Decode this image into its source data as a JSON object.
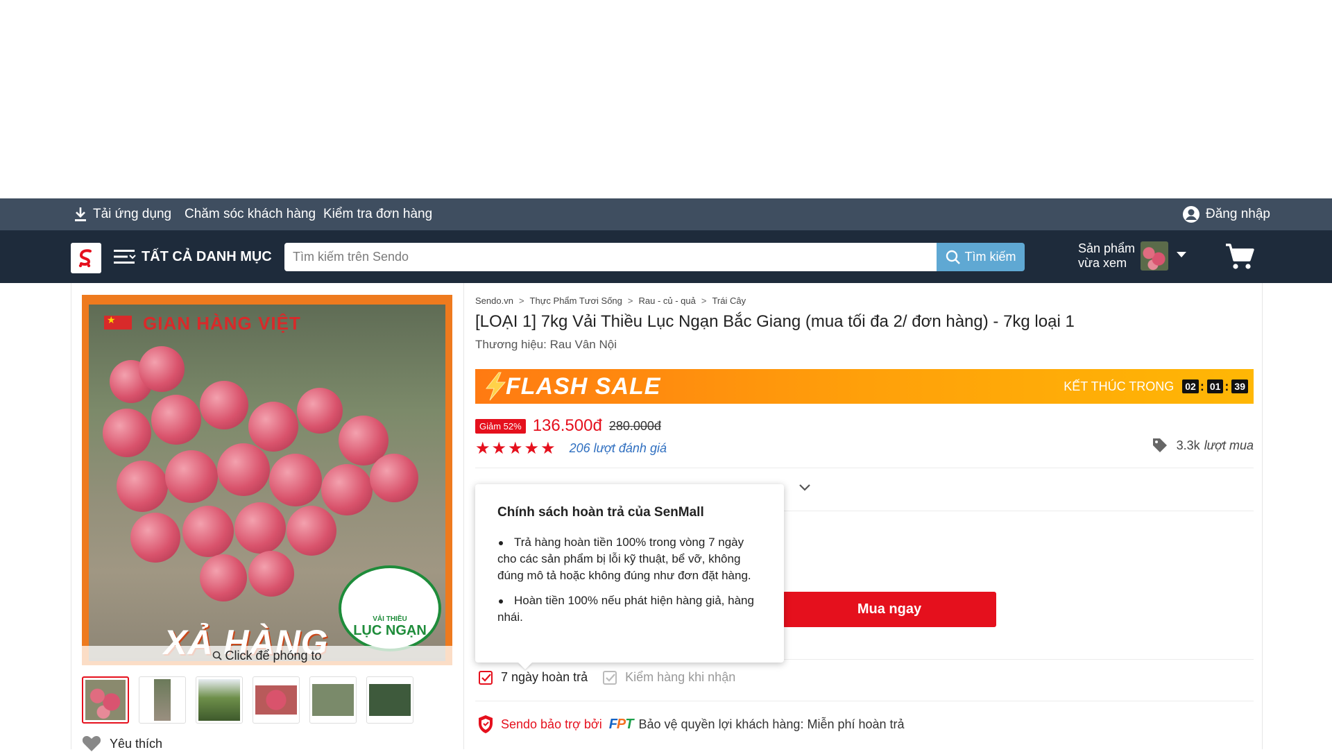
{
  "topbar": {
    "download_label": "Tải ứng dụng",
    "support_label": "Chăm sóc khách hàng",
    "order_check_label": "Kiểm tra đơn hàng",
    "login_label": "Đăng nhập"
  },
  "header": {
    "categories_label": "TẤT CẢ DANH MỤC",
    "search_placeholder": "Tìm kiếm trên Sendo",
    "search_button": "Tìm kiếm",
    "recent_line1": "Sản phẩm",
    "recent_line2": "vừa xem"
  },
  "gallery": {
    "banner_title": "GIAN HÀNG VIỆT",
    "banner_promo": "XẢ HÀNG",
    "seal_line1": "VẢI THIỀU",
    "seal_line2": "LỤC NGẠN",
    "zoom_label": "Click để phóng to",
    "like_label": "Yêu thích"
  },
  "breadcrumb": [
    "Sendo.vn",
    "Thực Phẩm Tươi Sống",
    "Rau - củ - quả",
    "Trái Cây"
  ],
  "product": {
    "title": "[LOẠI 1] 7kg Vải Thiều Lục Ngạn Bắc Giang (mua tối đa 2/ đơn hàng) - 7kg loại 1",
    "brand": "Thương hiệu: Rau Vân Nội",
    "discount_badge": "Giảm 52%",
    "price": "136.500đ",
    "old_price": "280.000đ",
    "stars": "★★★★★",
    "rating_count": "206 lượt đánh giá",
    "sold_count": "3.3k",
    "sold_unit": "lượt mua",
    "buy_now_label": "Mua ngay"
  },
  "flash_sale": {
    "label": "FLASH SALE",
    "ends_label": "KẾT THÚC TRONG",
    "hours": "02",
    "minutes": "01",
    "seconds": "39"
  },
  "return_tooltip": {
    "title": "Chính sách hoàn trả của SenMall",
    "items": [
      "Trả hàng hoàn tiền 100% trong vòng 7 ngày cho các sản phẩm bị lỗi kỹ thuật, bể vỡ, không đúng mô tả hoặc không đúng như đơn đặt hàng.",
      "Hoàn tiền 100% nếu phát hiện hàng giả, hàng nhái."
    ]
  },
  "policies": {
    "return_label": "7 ngày hoàn trả",
    "inspect_label": "Kiểm hàng khi nhận"
  },
  "protection": {
    "sponsor_label": "Sendo bảo trợ bởi",
    "partner": "FPT",
    "text": "Bảo vệ quyền lợi khách hàng: Miễn phí hoàn trả"
  },
  "colors": {
    "brand_red": "#e5101d",
    "topbar": "#3f4e60",
    "header": "#1e2b3b",
    "search_button": "#5fa8d3",
    "link_blue": "#2f6fc0"
  }
}
